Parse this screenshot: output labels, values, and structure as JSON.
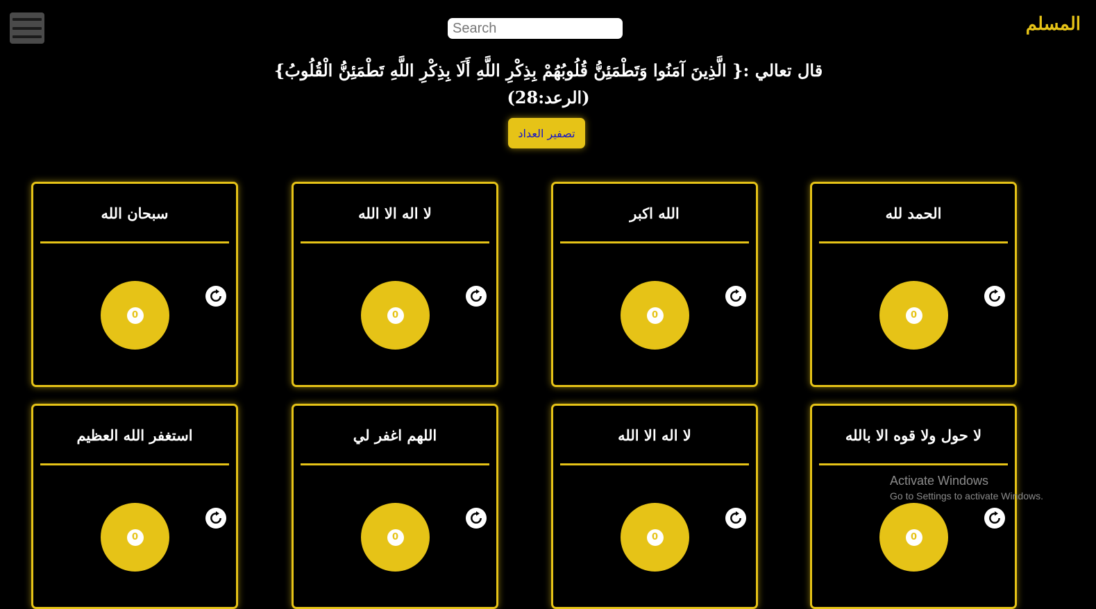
{
  "header": {
    "brand": "المسلم",
    "search_placeholder": "Search"
  },
  "verse": {
    "line1": "قال تعالي :{ الَّذِينَ آمَنُوا وَتَطْمَئِنُّ قُلُوبُهُمْ بِذِكْرِ اللَّهِ أَلَا بِذِكْرِ اللَّهِ تَطْمَئِنُّ الْقُلُوبُ}",
    "line2": "(الرعد:28)"
  },
  "reset_all_label": "تصفير العداد",
  "cards": [
    {
      "title": "الحمد لله",
      "count": "0"
    },
    {
      "title": "الله اكبر",
      "count": "0"
    },
    {
      "title": "لا اله الا الله",
      "count": "0"
    },
    {
      "title": "سبحان الله",
      "count": "0"
    },
    {
      "title": "لا حول ولا قوه الا بالله",
      "count": "0"
    },
    {
      "title": "لا اله الا الله",
      "count": "0"
    },
    {
      "title": "اللهم اغفر لي",
      "count": "0"
    },
    {
      "title": "استغفر الله العظيم",
      "count": "0"
    }
  ],
  "watermark": {
    "title": "Activate Windows",
    "subtitle": "Go to Settings to activate Windows."
  },
  "colors": {
    "accent": "#e6c317",
    "background": "#000000",
    "reset_button_text": "#1515c8"
  },
  "icons": {
    "menu": "hamburger-icon",
    "reset": "refresh-icon"
  }
}
